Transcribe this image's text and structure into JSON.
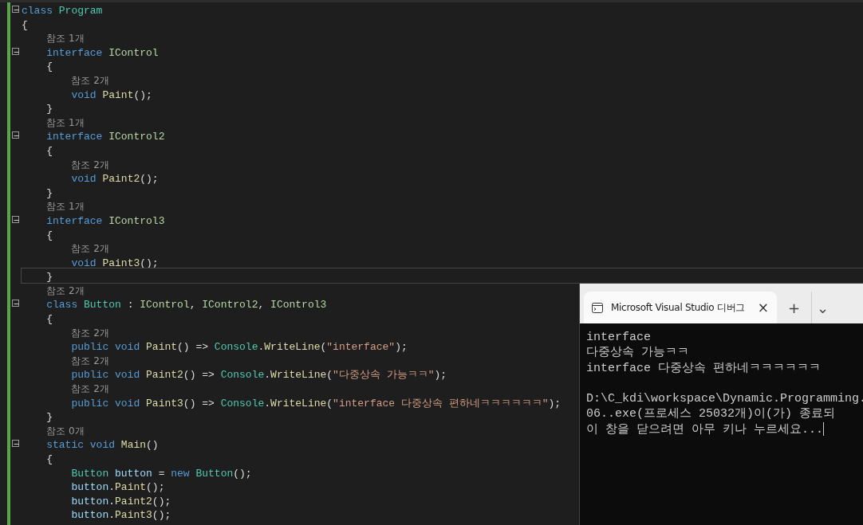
{
  "editor": {
    "lines": [
      {
        "kind": "code",
        "expanded": true,
        "tokens": [
          {
            "kind": "kw",
            "text": "class "
          },
          {
            "kind": "type",
            "text": "Program"
          }
        ]
      },
      {
        "kind": "code",
        "tokens": [
          {
            "kind": "plain",
            "text": "{"
          }
        ]
      },
      {
        "kind": "lens",
        "tokens": [
          {
            "kind": "plain",
            "text": "    참조 1개"
          }
        ]
      },
      {
        "kind": "code",
        "expanded": true,
        "tokens": [
          {
            "kind": "kw",
            "text": "    interface "
          },
          {
            "kind": "iface",
            "text": "IControl"
          }
        ]
      },
      {
        "kind": "code",
        "tokens": [
          {
            "kind": "plain",
            "text": "    {"
          }
        ]
      },
      {
        "kind": "lens",
        "tokens": [
          {
            "kind": "plain",
            "text": "        참조 2개"
          }
        ]
      },
      {
        "kind": "code",
        "tokens": [
          {
            "kind": "kw",
            "text": "        void "
          },
          {
            "kind": "method",
            "text": "Paint"
          },
          {
            "kind": "plain",
            "text": "();"
          }
        ]
      },
      {
        "kind": "code",
        "tokens": [
          {
            "kind": "plain",
            "text": "    }"
          }
        ]
      },
      {
        "kind": "lens",
        "tokens": [
          {
            "kind": "plain",
            "text": "    참조 1개"
          }
        ]
      },
      {
        "kind": "code",
        "expanded": true,
        "tokens": [
          {
            "kind": "kw",
            "text": "    interface "
          },
          {
            "kind": "iface",
            "text": "IControl2"
          }
        ]
      },
      {
        "kind": "code",
        "tokens": [
          {
            "kind": "plain",
            "text": "    {"
          }
        ]
      },
      {
        "kind": "lens",
        "tokens": [
          {
            "kind": "plain",
            "text": "        참조 2개"
          }
        ]
      },
      {
        "kind": "code",
        "tokens": [
          {
            "kind": "kw",
            "text": "        void "
          },
          {
            "kind": "method",
            "text": "Paint2"
          },
          {
            "kind": "plain",
            "text": "();"
          }
        ]
      },
      {
        "kind": "code",
        "tokens": [
          {
            "kind": "plain",
            "text": "    }"
          }
        ]
      },
      {
        "kind": "lens",
        "tokens": [
          {
            "kind": "plain",
            "text": "    참조 1개"
          }
        ]
      },
      {
        "kind": "code",
        "expanded": true,
        "tokens": [
          {
            "kind": "kw",
            "text": "    interface "
          },
          {
            "kind": "iface",
            "text": "IControl3"
          }
        ]
      },
      {
        "kind": "code",
        "tokens": [
          {
            "kind": "plain",
            "text": "    {"
          }
        ]
      },
      {
        "kind": "lens",
        "tokens": [
          {
            "kind": "plain",
            "text": "        참조 2개"
          }
        ]
      },
      {
        "kind": "code",
        "tokens": [
          {
            "kind": "kw",
            "text": "        void "
          },
          {
            "kind": "method",
            "text": "Paint3"
          },
          {
            "kind": "plain",
            "text": "();"
          }
        ]
      },
      {
        "kind": "code",
        "current": true,
        "tokens": [
          {
            "kind": "plain",
            "text": "    }"
          }
        ]
      },
      {
        "kind": "lens",
        "tokens": [
          {
            "kind": "plain",
            "text": "    참조 2개"
          }
        ]
      },
      {
        "kind": "code",
        "expanded": true,
        "tokens": [
          {
            "kind": "kw",
            "text": "    class "
          },
          {
            "kind": "type",
            "text": "Button"
          },
          {
            "kind": "plain",
            "text": " : "
          },
          {
            "kind": "iface",
            "text": "IControl"
          },
          {
            "kind": "plain",
            "text": ", "
          },
          {
            "kind": "iface",
            "text": "IControl2"
          },
          {
            "kind": "plain",
            "text": ", "
          },
          {
            "kind": "iface",
            "text": "IControl3"
          }
        ]
      },
      {
        "kind": "code",
        "tokens": [
          {
            "kind": "plain",
            "text": "    {"
          }
        ]
      },
      {
        "kind": "lens",
        "tokens": [
          {
            "kind": "plain",
            "text": "        참조 2개"
          }
        ]
      },
      {
        "kind": "code",
        "tokens": [
          {
            "kind": "kw",
            "text": "        public void "
          },
          {
            "kind": "method",
            "text": "Paint"
          },
          {
            "kind": "plain",
            "text": "() => "
          },
          {
            "kind": "type",
            "text": "Console"
          },
          {
            "kind": "plain",
            "text": "."
          },
          {
            "kind": "method",
            "text": "WriteLine"
          },
          {
            "kind": "plain",
            "text": "("
          },
          {
            "kind": "string",
            "text": "\"interface\""
          },
          {
            "kind": "plain",
            "text": ");"
          }
        ]
      },
      {
        "kind": "lens",
        "tokens": [
          {
            "kind": "plain",
            "text": "        참조 2개"
          }
        ]
      },
      {
        "kind": "code",
        "tokens": [
          {
            "kind": "kw",
            "text": "        public void "
          },
          {
            "kind": "method",
            "text": "Paint2"
          },
          {
            "kind": "plain",
            "text": "() => "
          },
          {
            "kind": "type",
            "text": "Console"
          },
          {
            "kind": "plain",
            "text": "."
          },
          {
            "kind": "method",
            "text": "WriteLine"
          },
          {
            "kind": "plain",
            "text": "("
          },
          {
            "kind": "string",
            "text": "\"다중상속 가능ㅋㅋ\""
          },
          {
            "kind": "plain",
            "text": ");"
          }
        ]
      },
      {
        "kind": "lens",
        "tokens": [
          {
            "kind": "plain",
            "text": "        참조 2개"
          }
        ]
      },
      {
        "kind": "code",
        "tokens": [
          {
            "kind": "kw",
            "text": "        public void "
          },
          {
            "kind": "method",
            "text": "Paint3"
          },
          {
            "kind": "plain",
            "text": "() => "
          },
          {
            "kind": "type",
            "text": "Console"
          },
          {
            "kind": "plain",
            "text": "."
          },
          {
            "kind": "method",
            "text": "WriteLine"
          },
          {
            "kind": "plain",
            "text": "("
          },
          {
            "kind": "string",
            "text": "\"interface 다중상속 편하네ㅋㅋㅋㅋㅋㅋ\""
          },
          {
            "kind": "plain",
            "text": ");"
          }
        ]
      },
      {
        "kind": "code",
        "tokens": [
          {
            "kind": "plain",
            "text": "    }"
          }
        ]
      },
      {
        "kind": "lens",
        "tokens": [
          {
            "kind": "plain",
            "text": "    참조 0개"
          }
        ]
      },
      {
        "kind": "code",
        "expanded": true,
        "tokens": [
          {
            "kind": "kw",
            "text": "    static void "
          },
          {
            "kind": "method",
            "text": "Main"
          },
          {
            "kind": "plain",
            "text": "()"
          }
        ]
      },
      {
        "kind": "code",
        "tokens": [
          {
            "kind": "plain",
            "text": "    {"
          }
        ]
      },
      {
        "kind": "code",
        "tokens": [
          {
            "kind": "type",
            "text": "        Button"
          },
          {
            "kind": "var",
            "text": " button"
          },
          {
            "kind": "plain",
            "text": " = "
          },
          {
            "kind": "kw",
            "text": "new "
          },
          {
            "kind": "type",
            "text": "Button"
          },
          {
            "kind": "plain",
            "text": "();"
          }
        ]
      },
      {
        "kind": "code",
        "tokens": [
          {
            "kind": "var",
            "text": "        button"
          },
          {
            "kind": "plain",
            "text": "."
          },
          {
            "kind": "method",
            "text": "Paint"
          },
          {
            "kind": "plain",
            "text": "();"
          }
        ]
      },
      {
        "kind": "code",
        "tokens": [
          {
            "kind": "var",
            "text": "        button"
          },
          {
            "kind": "plain",
            "text": "."
          },
          {
            "kind": "method",
            "text": "Paint2"
          },
          {
            "kind": "plain",
            "text": "();"
          }
        ]
      },
      {
        "kind": "code",
        "tokens": [
          {
            "kind": "var",
            "text": "        button"
          },
          {
            "kind": "plain",
            "text": "."
          },
          {
            "kind": "method",
            "text": "Paint3"
          },
          {
            "kind": "plain",
            "text": "();"
          }
        ]
      }
    ]
  },
  "terminal": {
    "tab": {
      "title": "Microsoft Visual Studio 디버그",
      "close": "×"
    },
    "new_tab": "+",
    "dropdown": "⌄",
    "lines": [
      {
        "kind": "text",
        "text": "interface"
      },
      {
        "kind": "text",
        "text": "다중상속 가능ㅋㅋ"
      },
      {
        "kind": "text",
        "text": "interface 다중상속 편하네ㅋㅋㅋㅋㅋㅋ"
      },
      {
        "kind": "blank"
      },
      {
        "kind": "text",
        "text": "D:\\C_kdi\\workspace\\Dynamic.Programming."
      },
      {
        "kind": "text",
        "text": "06..exe(프로세스 25032개)이(가) 종료되"
      },
      {
        "kind": "text",
        "text": "이 창을 닫으려면 아무 키나 누르세요..."
      }
    ]
  }
}
